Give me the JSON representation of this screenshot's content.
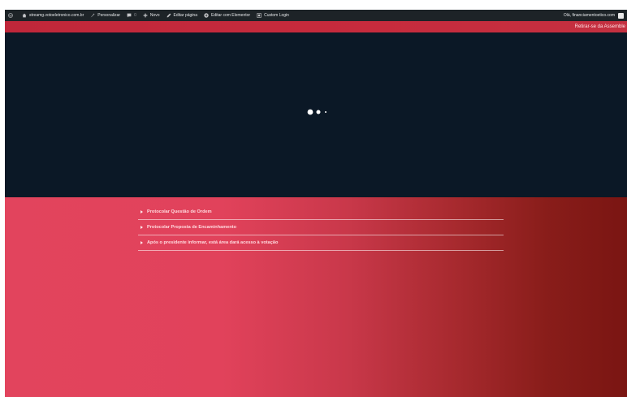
{
  "admin_bar": {
    "site": "streamg.votoeletronico.com.br",
    "customize": "Personalizar",
    "comments_count": "0",
    "new": "Novo",
    "edit_page": "Editar página",
    "edit_elementor": "Editar com Elementor",
    "custom_login": "Custom Login",
    "greeting": "Olá, financiamentoetico.com"
  },
  "header": {
    "leave_link": "Retirar-se da Assemble"
  },
  "accordion": {
    "items": [
      {
        "label": "Protocolar Questão de Ordem"
      },
      {
        "label": "Protocolar Proposta de Encaminhamento"
      },
      {
        "label": "Após o presidente informar, está área dará acesso à votação"
      }
    ]
  },
  "colors": {
    "admin_bar": "#1d2327",
    "header_red": "#c72b3d",
    "video_bg": "#0b1826",
    "gradient_start": "#e2445d",
    "gradient_end": "#7a1512"
  }
}
